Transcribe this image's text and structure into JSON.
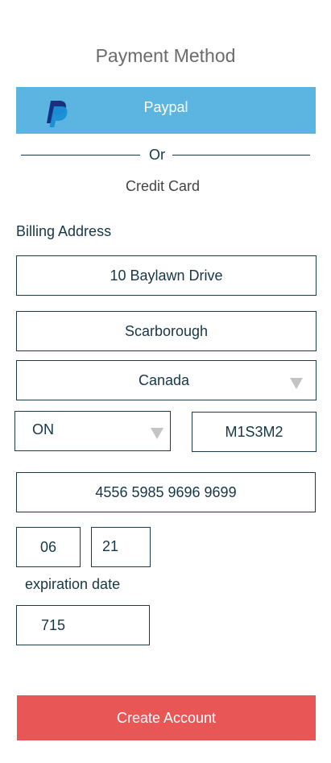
{
  "header": {
    "title": "Payment Method"
  },
  "paypal": {
    "label": "Paypal",
    "icon": "paypal-icon"
  },
  "divider": {
    "text": "Or"
  },
  "credit_card": {
    "label": "Credit Card"
  },
  "billing": {
    "label": "Billing Address",
    "street": "10 Baylawn Drive",
    "city": "Scarborough",
    "country": "Canada",
    "province": "ON",
    "postal_code": "M1S3M2"
  },
  "card": {
    "number": "4556 5985 9696 9699",
    "exp_month": "06",
    "exp_year": "21",
    "expiration_label": "expiration date",
    "cvv": "715"
  },
  "actions": {
    "create_account": "Create Account"
  },
  "colors": {
    "paypal_bg": "#5bb5e0",
    "create_bg": "#e95656",
    "text": "#163746"
  }
}
